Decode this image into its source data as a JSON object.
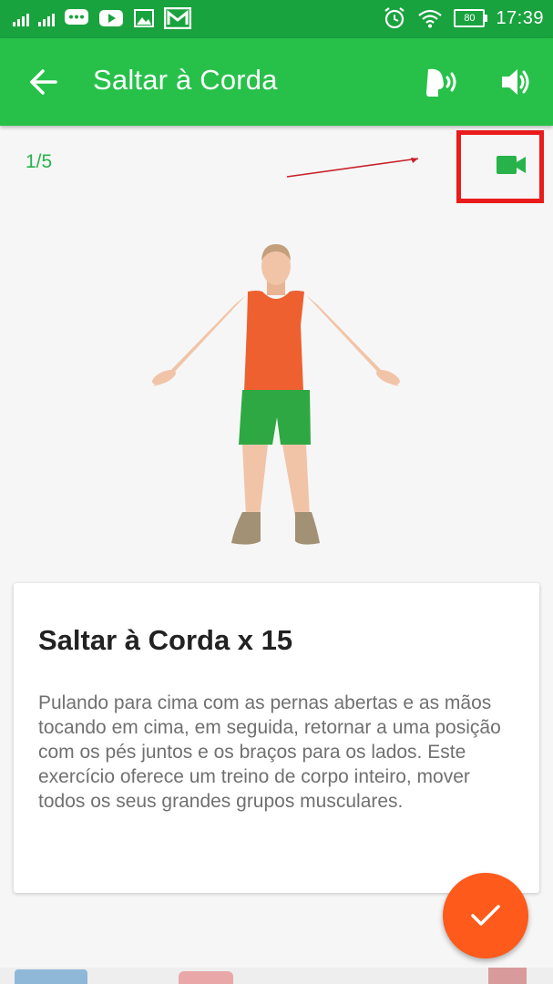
{
  "status_bar": {
    "time": "17:39",
    "battery": "80",
    "icons": [
      "signal-sim1-icon",
      "signal-sim2-icon",
      "message-icon",
      "youtube-icon",
      "gallery-icon",
      "gmail-icon",
      "alarm-icon",
      "wifi-icon",
      "battery-icon"
    ]
  },
  "app_bar": {
    "title": "Saltar à Corda",
    "icons": [
      "back-arrow-icon",
      "voice-coach-icon",
      "sound-icon"
    ]
  },
  "exercise": {
    "counter": "1/5",
    "video_icon": "video-camera-icon",
    "title": "Saltar à Corda x 15",
    "description": "Pulando para cima com as pernas abertas e as mãos tocando em cima, em seguida, retornar a uma posição com os pés juntos e os braços para os lados. Este exercício oferece um treino de corpo inteiro, mover todos os seus grandes grupos musculares."
  },
  "fab": {
    "icon": "check-icon"
  },
  "colors": {
    "status_bar": "#19a33e",
    "app_bar": "#27c14a",
    "accent_green": "#27b34a",
    "fab": "#fd5a1b",
    "highlight_box": "#ea1b1b"
  }
}
